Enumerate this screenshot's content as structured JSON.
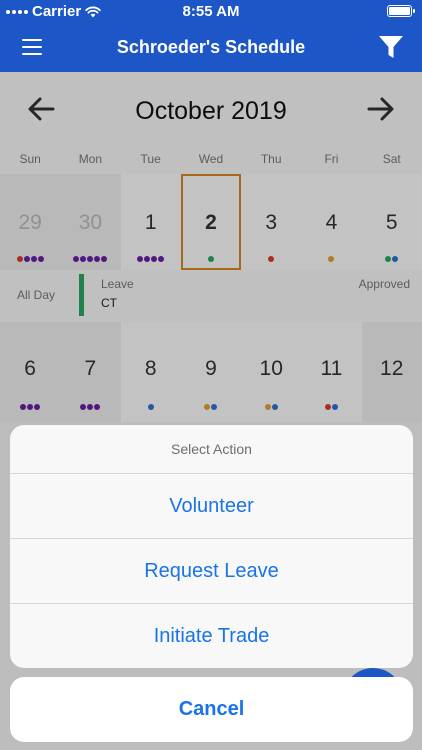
{
  "status_bar": {
    "carrier": "Carrier",
    "time": "8:55 AM"
  },
  "header": {
    "title": "Schroeder's Schedule",
    "menu_icon": "hamburger-menu-icon",
    "filter_icon": "filter-funnel-icon"
  },
  "calendar": {
    "month_label": "October 2019",
    "weekdays": [
      "Sun",
      "Mon",
      "Tue",
      "Wed",
      "Thu",
      "Fri",
      "Sat"
    ],
    "week1": [
      {
        "day": "29",
        "dots": [
          "#d63b2f",
          "#6a1fa3",
          "#6a1fa3",
          "#6a1fa3"
        ]
      },
      {
        "day": "30",
        "dots": [
          "#6a1fa3",
          "#6a1fa3",
          "#6a1fa3",
          "#6a1fa3",
          "#6a1fa3"
        ]
      },
      {
        "day": "1",
        "dots": [
          "#6a1fa3",
          "#6a1fa3",
          "#6a1fa3",
          "#6a1fa3"
        ]
      },
      {
        "day": "2",
        "dots": [
          "#2aa663"
        ]
      },
      {
        "day": "3",
        "dots": [
          "#d63b2f"
        ]
      },
      {
        "day": "4",
        "dots": [
          "#e0a030"
        ]
      },
      {
        "day": "5",
        "dots": [
          "#2aa663",
          "#2f6fd6"
        ]
      }
    ],
    "detail": {
      "all_day": "All Day",
      "leave_label": "Leave",
      "leave_code": "CT",
      "status": "Approved"
    },
    "week2": [
      {
        "day": "6",
        "dots": [
          "#6a1fa3",
          "#6a1fa3",
          "#6a1fa3"
        ]
      },
      {
        "day": "7",
        "dots": [
          "#6a1fa3",
          "#6a1fa3",
          "#6a1fa3"
        ]
      },
      {
        "day": "8",
        "dots": [
          "#2f6fd6"
        ]
      },
      {
        "day": "9",
        "dots": [
          "#e0a030",
          "#2f6fd6"
        ]
      },
      {
        "day": "10",
        "dots": [
          "#e0a030",
          "#2f6fd6"
        ]
      },
      {
        "day": "11",
        "dots": [
          "#d63b2f",
          "#2f6fd6"
        ]
      },
      {
        "day": "12",
        "dots": []
      }
    ]
  },
  "action_sheet": {
    "title": "Select Action",
    "actions": [
      "Volunteer",
      "Request Leave",
      "Initiate Trade"
    ],
    "cancel": "Cancel"
  }
}
